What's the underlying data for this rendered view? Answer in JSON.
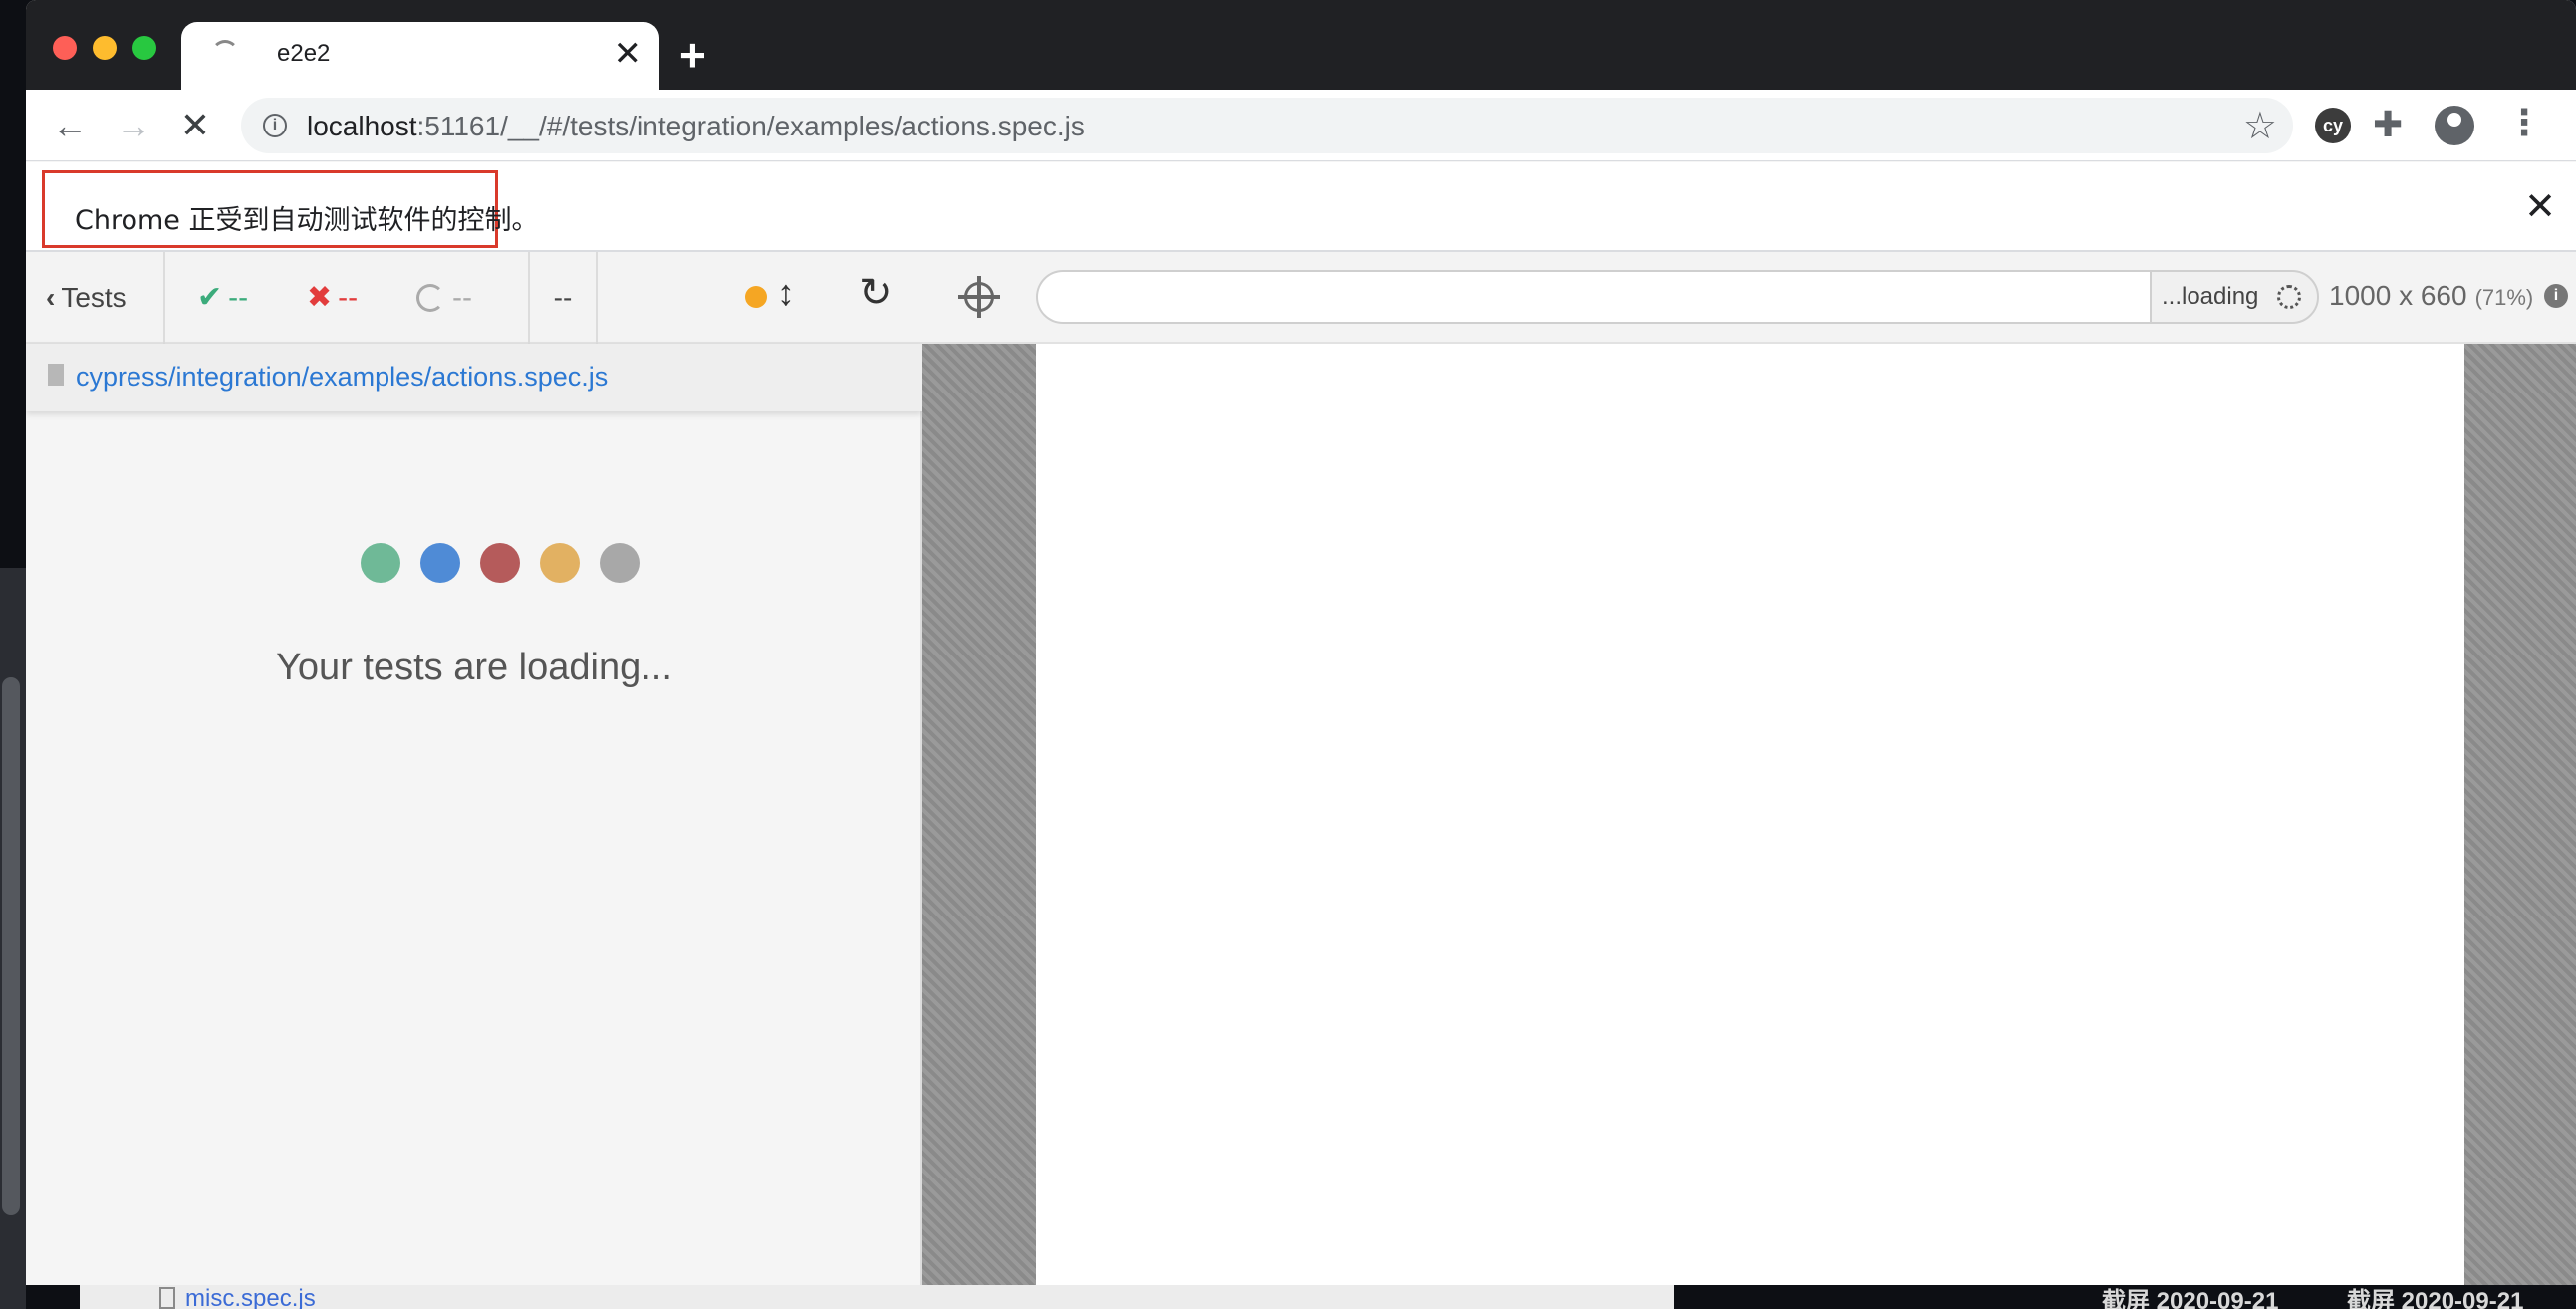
{
  "browser": {
    "tab_title": "e2e2",
    "new_tab_label": "+",
    "url_host": "localhost",
    "url_rest": ":51161/__/#/tests/integration/examples/actions.spec.js",
    "extension_label": "cy",
    "automation_banner": "Chrome 正受到自动测试软件的控制。"
  },
  "reporter": {
    "tests_label": "Tests",
    "passed": "--",
    "failed": "--",
    "pending": "--",
    "duration": "--",
    "spec_path": "cypress/integration/examples/actions.spec.js",
    "loading_message": "Your tests are loading...",
    "loader_dot_colors": [
      "#6fb997",
      "#4f8bd6",
      "#b55b5b",
      "#e2b162",
      "#a8a8a8"
    ],
    "status_color": "#f5a623"
  },
  "aut": {
    "loading_label": "...loading",
    "viewport": "1000 x 660",
    "scale": "(71%)"
  },
  "desktop": {
    "finder_file": "misc.spec.js",
    "screenshot_label_1": "截屏 2020-09-21",
    "screenshot_label_2": "截屏 2020-09-21"
  }
}
